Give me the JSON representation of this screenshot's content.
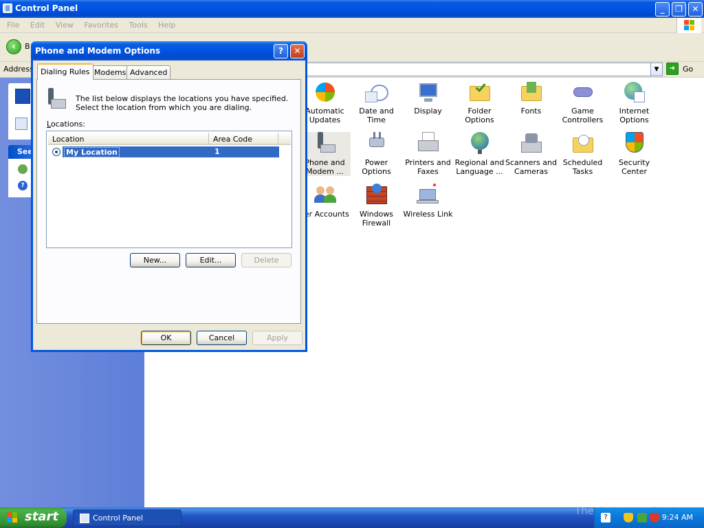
{
  "window": {
    "title": "Control Panel",
    "controls": {
      "minimize": "_",
      "restore": "❐",
      "close": "✕"
    }
  },
  "menu": {
    "items": [
      "File",
      "Edit",
      "View",
      "Favorites",
      "Tools",
      "Help"
    ]
  },
  "toolbar": {
    "back_label": "B"
  },
  "address": {
    "label": "Address",
    "value": "",
    "go_label": "Go"
  },
  "sidepane": {
    "see_also": "See"
  },
  "items": [
    {
      "label": "Automatic Updates",
      "icon": "automatic-updates-icon"
    },
    {
      "label": "Date and Time",
      "icon": "date-time-icon"
    },
    {
      "label": "Display",
      "icon": "display-icon"
    },
    {
      "label": "Folder Options",
      "icon": "folder-options-icon"
    },
    {
      "label": "Fonts",
      "icon": "fonts-icon"
    },
    {
      "label": "Game Controllers",
      "icon": "game-controllers-icon"
    },
    {
      "label": "Internet Options",
      "icon": "internet-options-icon"
    },
    {
      "label": "Phone and Modem ...",
      "icon": "phone-modem-icon"
    },
    {
      "label": "Power Options",
      "icon": "power-options-icon"
    },
    {
      "label": "Printers and Faxes",
      "icon": "printers-faxes-icon"
    },
    {
      "label": "Regional and Language ...",
      "icon": "regional-language-icon"
    },
    {
      "label": "Scanners and Cameras",
      "icon": "scanners-cameras-icon"
    },
    {
      "label": "Scheduled Tasks",
      "icon": "scheduled-tasks-icon"
    },
    {
      "label": "Security Center",
      "icon": "security-center-icon"
    },
    {
      "label": "ser Accounts",
      "icon": "user-accounts-icon"
    },
    {
      "label": "Windows Firewall",
      "icon": "windows-firewall-icon"
    },
    {
      "label": "Wireless Link",
      "icon": "wireless-link-icon"
    }
  ],
  "dialog": {
    "title": "Phone and Modem Options",
    "tabs": [
      "Dialing Rules",
      "Modems",
      "Advanced"
    ],
    "description": "The list below displays the locations you have specified. Select the location from which you are dialing.",
    "locations_label": "Locations:",
    "columns": [
      "Location",
      "Area Code"
    ],
    "rows": [
      {
        "location": "My Location",
        "area_code": "1",
        "selected": true
      }
    ],
    "buttons": {
      "new": "New...",
      "edit": "Edit...",
      "delete": "Delete",
      "ok": "OK",
      "cancel": "Cancel",
      "apply": "Apply"
    }
  },
  "taskbar": {
    "start_label": "start",
    "task_label": "Control Panel",
    "clock": "9:24 AM",
    "watermark": "The Collection Book"
  },
  "colors": {
    "titlebar": "#0054e3",
    "selection": "#316ac5",
    "dialog_bg": "#ece9d8",
    "start_green": "#3c9f3c"
  }
}
